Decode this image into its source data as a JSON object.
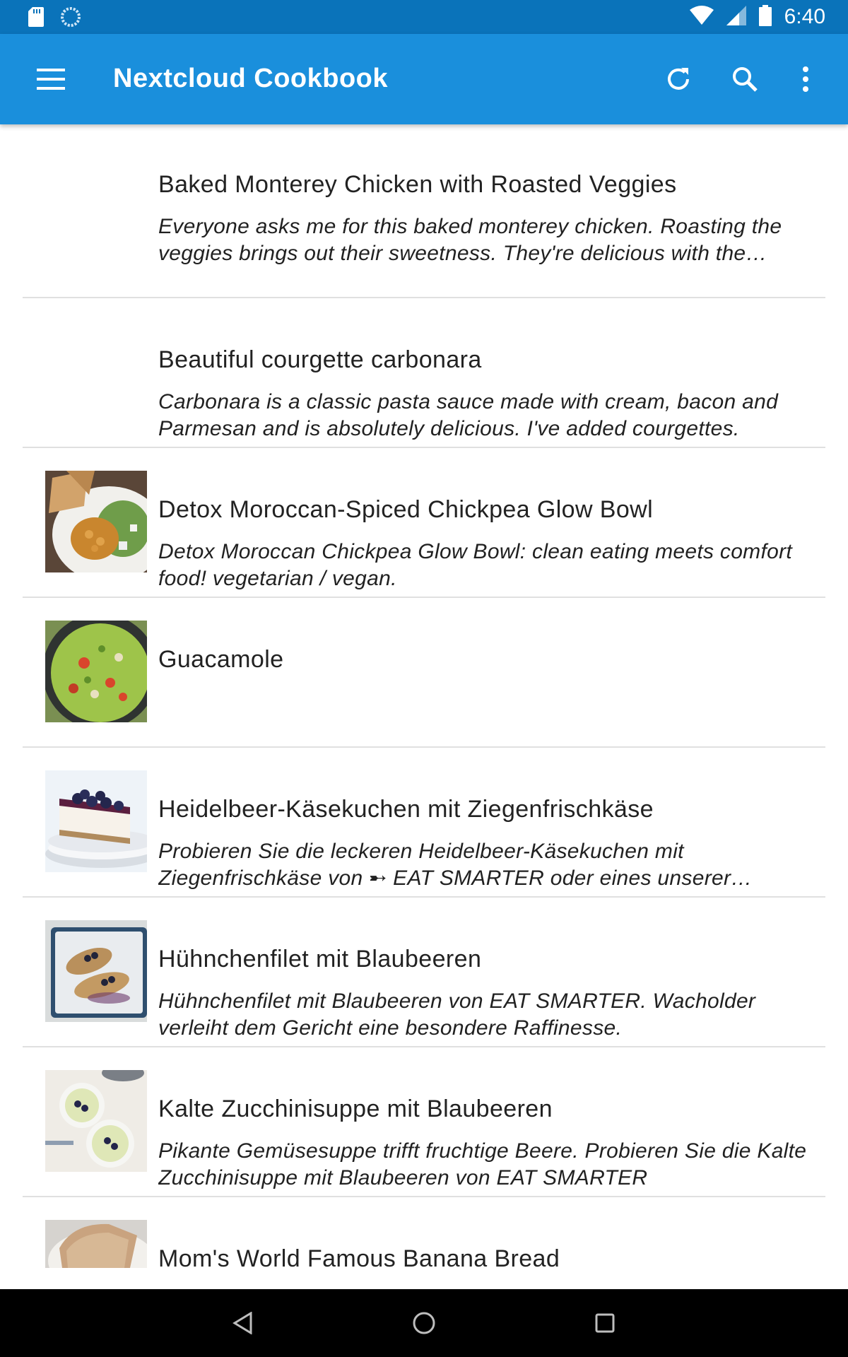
{
  "status_bar": {
    "time": "6:40",
    "icons": [
      "sd-card-icon",
      "sync-icon",
      "wifi-icon",
      "signal-icon",
      "battery-icon"
    ]
  },
  "app_bar": {
    "title": "Nextcloud Cookbook",
    "icons": [
      "menu-icon",
      "refresh-icon",
      "search-icon",
      "more-vert-icon"
    ]
  },
  "recipes": [
    {
      "title": "Baked Monterey Chicken with Roasted Veggies",
      "description": "Everyone asks me for this baked monterey chicken. Roasting the veggies brings out their sweetness. They're delicious with the chicken.",
      "image": "none"
    },
    {
      "title": "Beautiful courgette carbonara",
      "description": "Carbonara is a classic pasta sauce made with cream, bacon and Parmesan and is absolutely delicious. I've added courgettes.",
      "image": "none"
    },
    {
      "title": "Detox Moroccan-Spiced Chickpea Glow Bowl",
      "description": "Detox Moroccan Chickpea Glow Bowl: clean eating meets comfort food! vegetarian / vegan.",
      "image": "chickpea-bowl-photo"
    },
    {
      "title": "Guacamole",
      "description": "",
      "image": "guacamole-photo"
    },
    {
      "title": "Heidelbeer-Käsekuchen mit Ziegenfrischkäse",
      "description": "Probieren Sie die leckeren Heidelbeer-Käsekuchen mit Ziegenfrischkäse von ➸ EAT SMARTER oder eines unserer anderen Rezepte.",
      "image": "cheesecake-photo"
    },
    {
      "title": "Hühnchenfilet mit Blaubeeren",
      "description": "Hühnchenfilet mit Blaubeeren von EAT SMARTER. Wacholder verleiht dem Gericht eine besondere Raffinesse.",
      "image": "chicken-blueberry-photo"
    },
    {
      "title": "Kalte Zucchinisuppe mit Blaubeeren",
      "description": "Pikante Gemüsesuppe trifft fruchtige Beere. Probieren Sie die Kalte Zucchinisuppe mit Blaubeeren von EAT SMARTER",
      "image": "zucchini-soup-photo"
    },
    {
      "title": "Mom's World Famous Banana Bread",
      "description": "",
      "image": "banana-bread-photo"
    }
  ],
  "nav_bar": {
    "icons": [
      "back-icon",
      "home-icon",
      "recents-icon"
    ]
  },
  "colors": {
    "status_bar": "#0A73BA",
    "app_bar": "#1A8FDC",
    "divider": "#E0E0E0"
  }
}
